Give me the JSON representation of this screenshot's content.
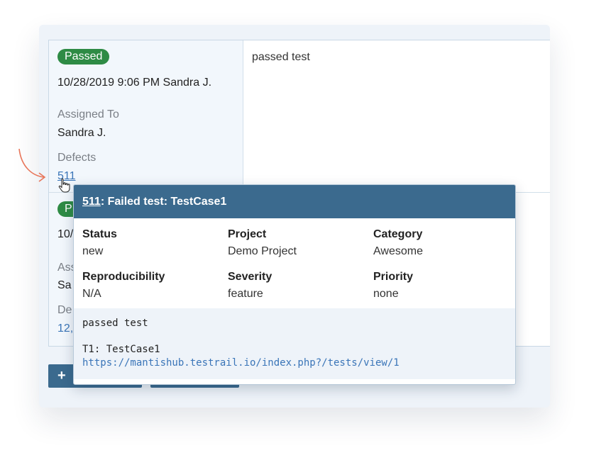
{
  "results": [
    {
      "status": "Passed",
      "meta": "10/28/2019 9:06 PM Sandra J.",
      "assigned_label": "Assigned To",
      "assigned_value": "Sandra J.",
      "defects_label": "Defects",
      "defects_value": "511",
      "comment": "passed test"
    },
    {
      "status_partial": "P",
      "meta_partial": "10/",
      "assigned_partial": "Ass",
      "assigned_value_partial": "Sa",
      "defects_partial": "De",
      "defects_value_partial": "12,"
    }
  ],
  "buttons": {
    "add_icon": "+"
  },
  "popup": {
    "defect_id": "511",
    "title_rest": ": Failed test: TestCase1",
    "fields": {
      "status_label": "Status",
      "status_value": "new",
      "project_label": "Project",
      "project_value": "Demo Project",
      "category_label": "Category",
      "category_value": "Awesome",
      "repro_label": "Reproducibility",
      "repro_value": "N/A",
      "severity_label": "Severity",
      "severity_value": "feature",
      "priority_label": "Priority",
      "priority_value": "none"
    },
    "description": "passed test",
    "test_ref": "T1: TestCase1",
    "test_url": "https://mantishub.testrail.io/index.php?/tests/view/1"
  },
  "colors": {
    "passed": "#2e8b45",
    "header": "#3b6a8e",
    "link": "#3a75b8",
    "arrow": "#e8765a"
  },
  "icons": [
    "hand-pointer-icon",
    "curved-arrow-icon",
    "plus-icon"
  ]
}
